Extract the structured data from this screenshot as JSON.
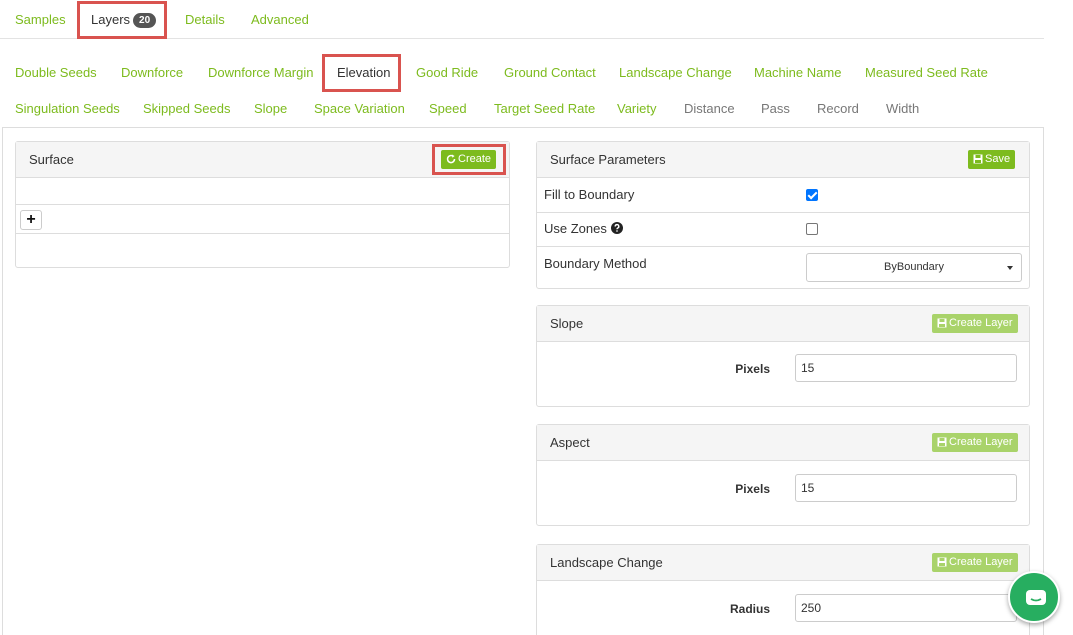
{
  "top_tabs": {
    "samples": "Samples",
    "layers": "Layers",
    "layers_count": "20",
    "details": "Details",
    "advanced": "Advanced"
  },
  "layer_links": [
    "Double Seeds",
    "Downforce",
    "Downforce Margin",
    "Elevation",
    "Good Ride",
    "Ground Contact",
    "Landscape Change",
    "Machine Name",
    "Measured Seed Rate",
    "Singulation Seeds",
    "Skipped Seeds",
    "Slope",
    "Space Variation",
    "Speed",
    "Target Seed Rate",
    "Variety",
    "Distance",
    "Pass",
    "Record",
    "Width"
  ],
  "surface_panel": {
    "title": "Surface",
    "create_label": "Create",
    "add_symbol": "+"
  },
  "surface_params": {
    "title": "Surface Parameters",
    "save_label": "Save",
    "fill_to_boundary_label": "Fill to Boundary",
    "fill_to_boundary_checked": true,
    "use_zones_label": "Use Zones",
    "use_zones_checked": false,
    "boundary_method_label": "Boundary Method",
    "boundary_method_value": "ByBoundary"
  },
  "slope_panel": {
    "title": "Slope",
    "create_layer_label": "Create Layer",
    "field_label": "Pixels",
    "field_value": "15"
  },
  "aspect_panel": {
    "title": "Aspect",
    "create_layer_label": "Create Layer",
    "field_label": "Pixels",
    "field_value": "15"
  },
  "landscape_panel": {
    "title": "Landscape Change",
    "create_layer_label": "Create Layer",
    "field_label": "Radius",
    "field_value": "250"
  },
  "colors": {
    "accent": "#7dbb1e",
    "accent_disabled": "#a9d36a",
    "highlight": "#d9534f",
    "chat": "#27ae60"
  }
}
